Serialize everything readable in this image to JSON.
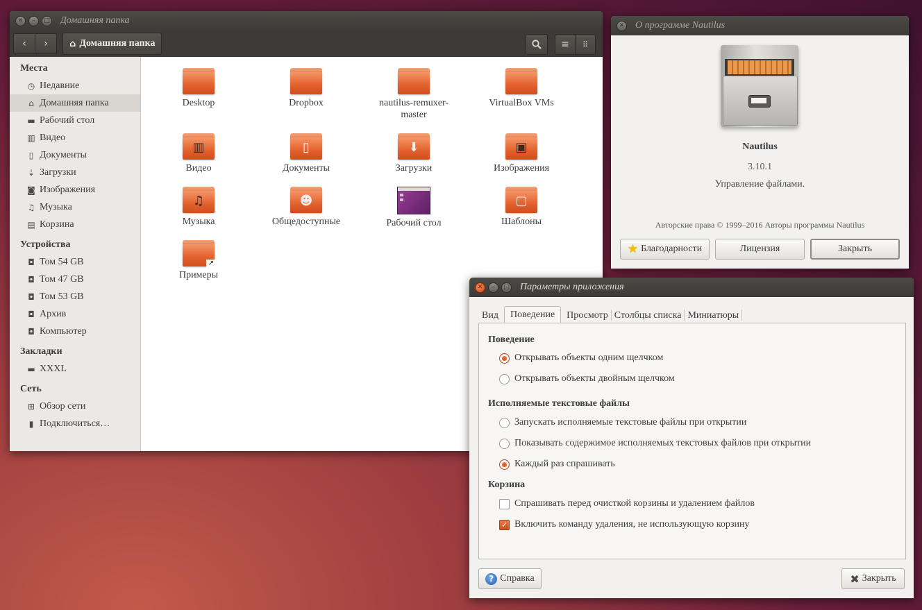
{
  "main_window": {
    "title": "Домашняя папка",
    "path_button": "Домашняя папка",
    "sidebar": {
      "places_header": "Места",
      "places": [
        {
          "label": "Недавние",
          "icon": "clock-icon"
        },
        {
          "label": "Домашняя папка",
          "icon": "home-icon"
        },
        {
          "label": "Рабочий стол",
          "icon": "desktop-folder-icon"
        },
        {
          "label": "Видео",
          "icon": "film-icon"
        },
        {
          "label": "Документы",
          "icon": "document-icon"
        },
        {
          "label": "Загрузки",
          "icon": "download-icon"
        },
        {
          "label": "Изображения",
          "icon": "camera-icon"
        },
        {
          "label": "Музыка",
          "icon": "music-icon"
        },
        {
          "label": "Корзина",
          "icon": "trash-icon"
        }
      ],
      "devices_header": "Устройства",
      "devices": [
        {
          "label": "Том 54 GB"
        },
        {
          "label": "Том 47 GB"
        },
        {
          "label": "Том 53 GB"
        },
        {
          "label": "Архив"
        },
        {
          "label": "Компьютер"
        }
      ],
      "bookmarks_header": "Закладки",
      "bookmarks": [
        {
          "label": "XXXL"
        }
      ],
      "network_header": "Сеть",
      "network": [
        {
          "label": "Обзор сети"
        },
        {
          "label": "Подключиться…"
        }
      ]
    },
    "files": [
      {
        "name": "Desktop"
      },
      {
        "name": "Dropbox"
      },
      {
        "name": "nautilus-remuxer-master"
      },
      {
        "name": "VirtualBox VMs"
      },
      {
        "name": "Видео",
        "emblem": "film-icon"
      },
      {
        "name": "Документы",
        "emblem": "document-icon"
      },
      {
        "name": "Загрузки",
        "emblem": "download-icon"
      },
      {
        "name": "Изображения",
        "emblem": "image-icon"
      },
      {
        "name": "Музыка",
        "emblem": "music-icon"
      },
      {
        "name": "Общедоступные",
        "emblem": "person-icon"
      },
      {
        "name": "Рабочий стол",
        "emblem": "desktop-icon"
      },
      {
        "name": "Шаблоны",
        "emblem": "template-icon"
      },
      {
        "name": "Примеры",
        "emblem": "link-arrow-icon"
      }
    ]
  },
  "about_dialog": {
    "title": "О программе Nautilus",
    "app_name": "Nautilus",
    "version": "3.10.1",
    "description": "Управление файлами.",
    "copyright": "Авторские права © 1999–2016 Авторы программы Nautilus",
    "credits_button": "Благодарности",
    "license_button": "Лицензия",
    "close_button": "Закрыть"
  },
  "prefs_dialog": {
    "title": "Параметры приложения",
    "tabs": [
      "Вид",
      "Поведение",
      "Просмотр",
      "Столбцы списка",
      "Миниатюры"
    ],
    "active_tab": "Поведение",
    "behavior_header": "Поведение",
    "single_click": "Открывать объекты одним щелчком",
    "double_click": "Открывать объекты двойным щелчком",
    "exec_header": "Исполняемые текстовые файлы",
    "exec_run": "Запускать исполняемые текстовые файлы при открытии",
    "exec_show": "Показывать содержимое исполняемых текстовых файлов при открытии",
    "exec_ask": "Каждый раз спрашивать",
    "trash_header": "Корзина",
    "trash_ask": "Спрашивать перед очисткой корзины и удалением файлов",
    "trash_delete": "Включить команду удаления, не использующую корзину",
    "help_button": "Справка",
    "close_button": "Закрыть"
  },
  "colors": {
    "accent": "#e95420",
    "titlebar": "#3c3b37"
  }
}
